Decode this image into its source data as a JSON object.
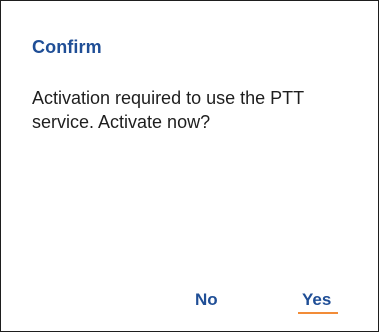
{
  "dialog": {
    "title": "Confirm",
    "message": "Activation required to use the PTT service. Activate now?",
    "buttons": {
      "no_label": "No",
      "yes_label": "Yes"
    },
    "colors": {
      "accent": "#1f4e96",
      "text": "#1e1e1e",
      "focus": "#f28c38"
    }
  }
}
